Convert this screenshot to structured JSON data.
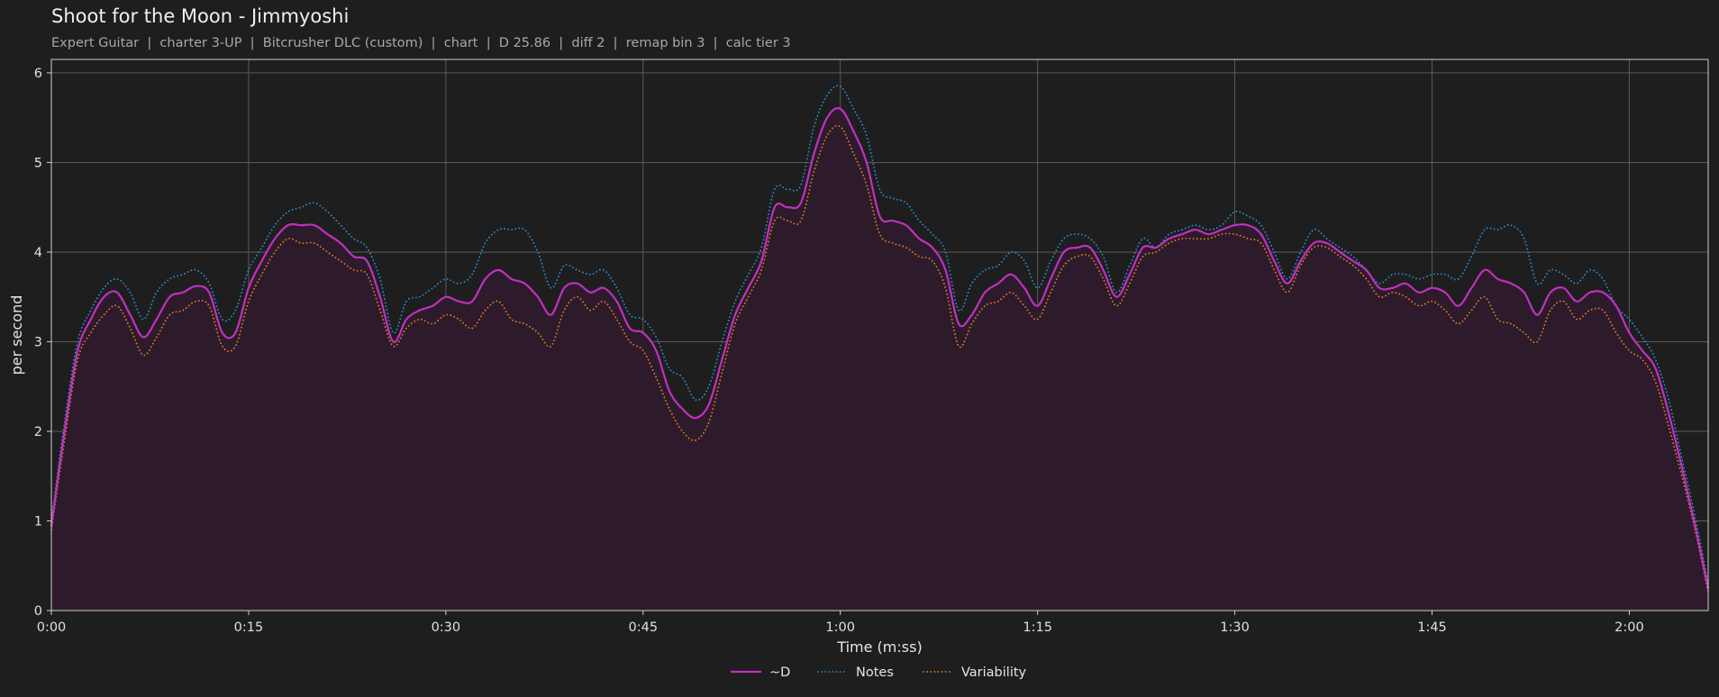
{
  "title": "Shoot for the Moon - Jimmyoshi",
  "subtitle": "Expert Guitar  |  charter 3-UP  |  Bitcrusher DLC (custom)  |  chart  |  D 25.86  |  diff 2  |  remap bin 3  |  calc tier 3",
  "chart_data": {
    "type": "line",
    "xlabel": "Time (m:ss)",
    "ylabel": "per second",
    "xlim": [
      0,
      126
    ],
    "ylim": [
      0,
      6.15
    ],
    "x_ticks": [
      0,
      15,
      30,
      45,
      60,
      75,
      90,
      105,
      120
    ],
    "x_tick_labels": [
      "0:00",
      "0:15",
      "0:30",
      "0:45",
      "1:00",
      "1:15",
      "1:30",
      "1:45",
      "2:00"
    ],
    "y_ticks": [
      0,
      1,
      2,
      3,
      4,
      5,
      6
    ],
    "y_tick_labels": [
      "0",
      "1",
      "2",
      "3",
      "4",
      "5",
      "6"
    ],
    "grid": true,
    "legend_position": "bottom-center",
    "x": [
      0,
      1,
      2,
      3,
      4,
      5,
      6,
      7,
      8,
      9,
      10,
      11,
      12,
      13,
      14,
      15,
      16,
      17,
      18,
      19,
      20,
      21,
      22,
      23,
      24,
      25,
      26,
      27,
      28,
      29,
      30,
      31,
      32,
      33,
      34,
      35,
      36,
      37,
      38,
      39,
      40,
      41,
      42,
      43,
      44,
      45,
      46,
      47,
      48,
      49,
      50,
      51,
      52,
      53,
      54,
      55,
      56,
      57,
      58,
      59,
      60,
      61,
      62,
      63,
      64,
      65,
      66,
      67,
      68,
      69,
      70,
      71,
      72,
      73,
      74,
      75,
      76,
      77,
      78,
      79,
      80,
      81,
      82,
      83,
      84,
      85,
      86,
      87,
      88,
      89,
      90,
      91,
      92,
      93,
      94,
      95,
      96,
      97,
      98,
      99,
      100,
      101,
      102,
      103,
      104,
      105,
      106,
      107,
      108,
      109,
      110,
      111,
      112,
      113,
      114,
      115,
      116,
      117,
      118,
      119,
      120,
      121,
      122,
      123,
      124,
      125,
      126
    ],
    "series": [
      {
        "name": "~D",
        "color": "#c030c0",
        "style": "solid",
        "values": [
          0.95,
          2.0,
          2.9,
          3.25,
          3.5,
          3.55,
          3.3,
          3.05,
          3.25,
          3.5,
          3.55,
          3.62,
          3.55,
          3.1,
          3.1,
          3.6,
          3.9,
          4.15,
          4.3,
          4.3,
          4.3,
          4.2,
          4.1,
          3.95,
          3.9,
          3.5,
          3.0,
          3.25,
          3.35,
          3.4,
          3.5,
          3.45,
          3.45,
          3.7,
          3.8,
          3.7,
          3.65,
          3.5,
          3.3,
          3.6,
          3.65,
          3.55,
          3.6,
          3.45,
          3.15,
          3.1,
          2.9,
          2.45,
          2.25,
          2.15,
          2.3,
          2.8,
          3.3,
          3.6,
          3.9,
          4.5,
          4.5,
          4.55,
          5.1,
          5.5,
          5.6,
          5.35,
          5.0,
          4.4,
          4.35,
          4.3,
          4.15,
          4.05,
          3.8,
          3.2,
          3.3,
          3.55,
          3.65,
          3.75,
          3.6,
          3.4,
          3.7,
          4.0,
          4.05,
          4.05,
          3.8,
          3.5,
          3.75,
          4.05,
          4.05,
          4.15,
          4.2,
          4.25,
          4.2,
          4.25,
          4.3,
          4.3,
          4.2,
          3.9,
          3.65,
          3.9,
          4.1,
          4.1,
          4.0,
          3.9,
          3.8,
          3.6,
          3.6,
          3.65,
          3.55,
          3.6,
          3.55,
          3.4,
          3.6,
          3.8,
          3.7,
          3.65,
          3.55,
          3.3,
          3.55,
          3.6,
          3.45,
          3.55,
          3.55,
          3.4,
          3.1,
          2.9,
          2.7,
          2.2,
          1.6,
          0.95,
          0.25
        ]
      },
      {
        "name": "Notes",
        "color": "#2a8ad0",
        "style": "dotted",
        "values": [
          1.0,
          2.1,
          3.0,
          3.35,
          3.6,
          3.7,
          3.55,
          3.25,
          3.55,
          3.7,
          3.75,
          3.8,
          3.65,
          3.25,
          3.35,
          3.8,
          4.05,
          4.3,
          4.45,
          4.5,
          4.55,
          4.45,
          4.3,
          4.15,
          4.05,
          3.7,
          3.1,
          3.45,
          3.5,
          3.6,
          3.7,
          3.65,
          3.75,
          4.1,
          4.25,
          4.25,
          4.25,
          4.0,
          3.6,
          3.85,
          3.8,
          3.75,
          3.8,
          3.6,
          3.3,
          3.25,
          3.05,
          2.7,
          2.6,
          2.35,
          2.5,
          3.0,
          3.45,
          3.75,
          4.05,
          4.7,
          4.7,
          4.75,
          5.4,
          5.75,
          5.85,
          5.6,
          5.3,
          4.7,
          4.6,
          4.55,
          4.35,
          4.2,
          4.0,
          3.35,
          3.65,
          3.8,
          3.85,
          4.0,
          3.9,
          3.6,
          3.9,
          4.15,
          4.2,
          4.15,
          3.95,
          3.55,
          3.85,
          4.15,
          4.05,
          4.2,
          4.25,
          4.3,
          4.25,
          4.3,
          4.45,
          4.4,
          4.3,
          4.0,
          3.7,
          4.0,
          4.25,
          4.15,
          4.05,
          3.95,
          3.8,
          3.65,
          3.75,
          3.75,
          3.7,
          3.75,
          3.75,
          3.7,
          3.95,
          4.25,
          4.25,
          4.3,
          4.15,
          3.65,
          3.8,
          3.75,
          3.65,
          3.8,
          3.7,
          3.4,
          3.25,
          3.05,
          2.8,
          2.35,
          1.7,
          1.05,
          0.3
        ]
      },
      {
        "name": "Variability",
        "color": "#e07a20",
        "style": "dotted",
        "values": [
          0.9,
          1.9,
          2.8,
          3.1,
          3.3,
          3.4,
          3.15,
          2.85,
          3.05,
          3.3,
          3.35,
          3.45,
          3.4,
          2.95,
          2.95,
          3.45,
          3.75,
          4.0,
          4.15,
          4.1,
          4.1,
          4.0,
          3.9,
          3.8,
          3.75,
          3.35,
          2.95,
          3.15,
          3.25,
          3.2,
          3.3,
          3.25,
          3.15,
          3.35,
          3.45,
          3.25,
          3.2,
          3.1,
          2.95,
          3.35,
          3.5,
          3.35,
          3.45,
          3.25,
          3.0,
          2.9,
          2.6,
          2.25,
          2.0,
          1.9,
          2.1,
          2.65,
          3.2,
          3.5,
          3.8,
          4.35,
          4.35,
          4.35,
          4.9,
          5.3,
          5.4,
          5.1,
          4.75,
          4.2,
          4.1,
          4.05,
          3.95,
          3.9,
          3.6,
          2.95,
          3.2,
          3.4,
          3.45,
          3.55,
          3.4,
          3.25,
          3.55,
          3.85,
          3.95,
          3.95,
          3.7,
          3.4,
          3.65,
          3.95,
          4.0,
          4.1,
          4.15,
          4.15,
          4.15,
          4.2,
          4.2,
          4.15,
          4.1,
          3.8,
          3.55,
          3.85,
          4.05,
          4.05,
          3.95,
          3.85,
          3.7,
          3.5,
          3.55,
          3.5,
          3.4,
          3.45,
          3.35,
          3.2,
          3.35,
          3.5,
          3.25,
          3.2,
          3.1,
          3.0,
          3.35,
          3.45,
          3.25,
          3.35,
          3.35,
          3.1,
          2.9,
          2.8,
          2.55,
          2.05,
          1.5,
          0.9,
          0.2
        ]
      }
    ],
    "fill_under": "~D",
    "fill_color": "#2d1b2c"
  }
}
